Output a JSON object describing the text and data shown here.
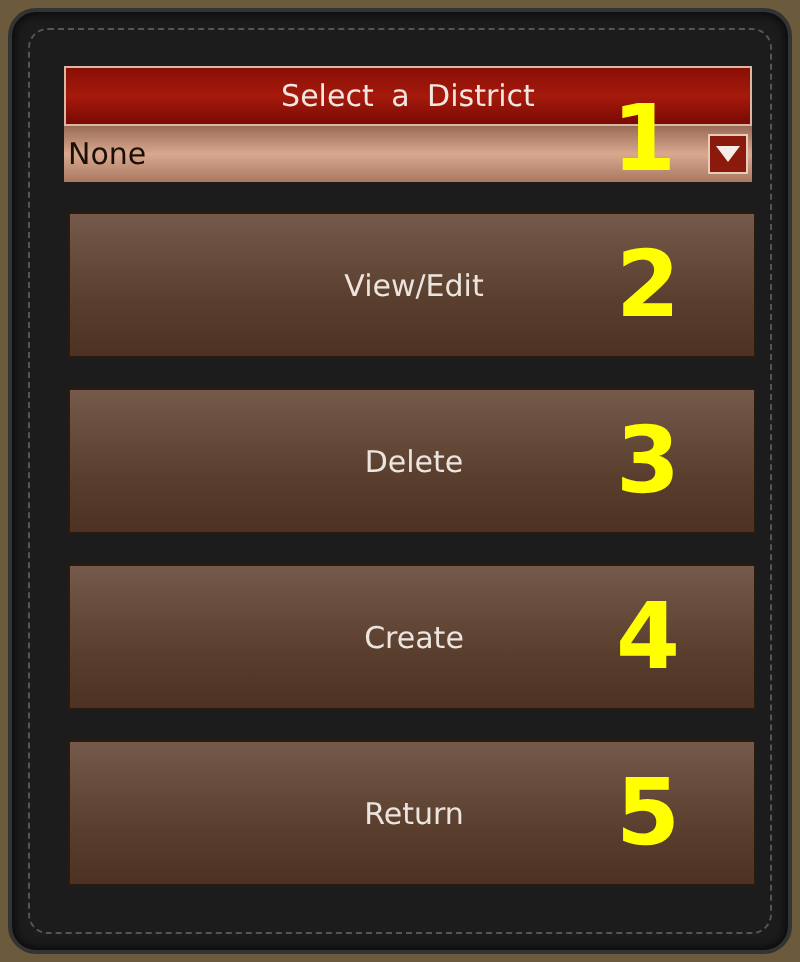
{
  "district_selector": {
    "title": "Select a District",
    "value": "None",
    "callout": "1"
  },
  "buttons": [
    {
      "label": "View/Edit",
      "callout": "2"
    },
    {
      "label": "Delete",
      "callout": "3"
    },
    {
      "label": "Create",
      "callout": "4"
    },
    {
      "label": "Return",
      "callout": "5"
    }
  ]
}
